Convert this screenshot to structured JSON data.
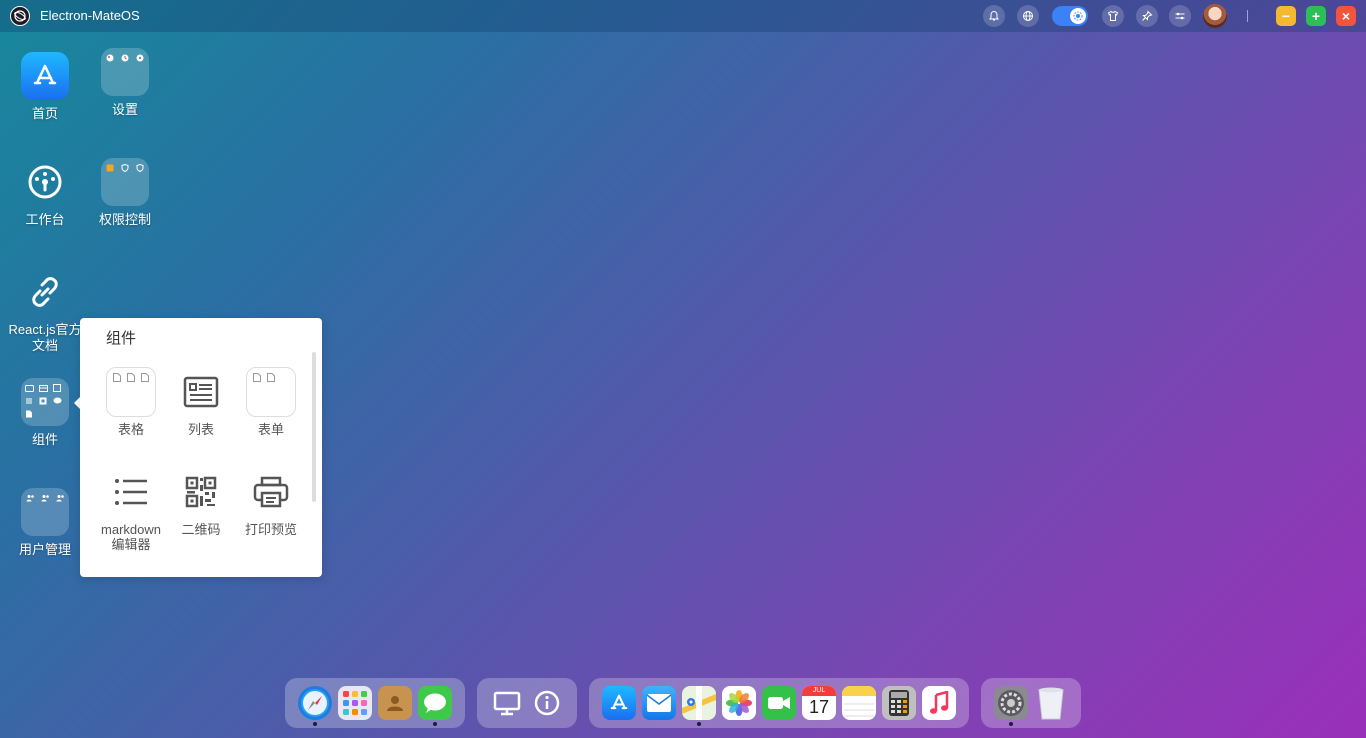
{
  "window": {
    "title": "Electron-MateOS"
  },
  "topbar": {
    "icons": [
      "bell-icon",
      "globe-icon",
      "theme-toggle",
      "shirt-icon",
      "pin-icon",
      "sliders-icon",
      "avatar"
    ]
  },
  "window_controls": {
    "minimize": "−",
    "maximize": "+",
    "close": "×"
  },
  "desktop": {
    "items": [
      {
        "label": "首页"
      },
      {
        "label": "设置"
      },
      {
        "label": "工作台"
      },
      {
        "label": "权限控制"
      },
      {
        "label": "React.js官方文档"
      },
      {
        "label": "组件"
      },
      {
        "label": "用户管理"
      }
    ]
  },
  "panel": {
    "title": "组件",
    "items": [
      {
        "label": "表格"
      },
      {
        "label": "列表"
      },
      {
        "label": "表单"
      },
      {
        "label": "markdown编辑器"
      },
      {
        "label": "二维码"
      },
      {
        "label": "打印预览"
      }
    ]
  },
  "dock": {
    "calendar_month": "JUL",
    "calendar_day": "17",
    "colors": {
      "accent": "#3b82f6",
      "min": "#f5b82e",
      "max": "#2bbf57",
      "close": "#f2553a"
    }
  }
}
